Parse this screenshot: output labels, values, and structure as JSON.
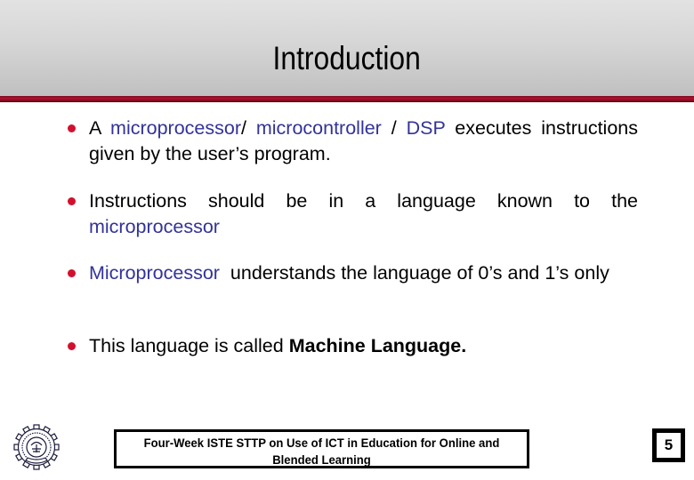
{
  "slide": {
    "title": "Introduction",
    "colors": {
      "accent_bar": "#b0102e",
      "bullet": "#d2102e",
      "highlight_text": "#333399",
      "header_gradient_top": "#e2e2e2",
      "header_gradient_bottom": "#c0c0c0"
    }
  },
  "bullets": [
    {
      "segments": [
        {
          "text": "A ",
          "style": "normal"
        },
        {
          "text": "microprocessor",
          "style": "blue"
        },
        {
          "text": "/ ",
          "style": "normal"
        },
        {
          "text": "microcontroller",
          "style": "blue"
        },
        {
          "text": " / ",
          "style": "normal"
        },
        {
          "text": "DSP",
          "style": "blue"
        },
        {
          "text": " executes instructions given by the user’s program.",
          "style": "normal"
        }
      ]
    },
    {
      "segments": [
        {
          "text": "Instructions should be in a language known to the ",
          "style": "normal"
        },
        {
          "text": "microprocessor",
          "style": "blue"
        }
      ]
    },
    {
      "segments": [
        {
          "text": "Microprocessor",
          "style": "blue"
        },
        {
          "text": "  understands the language of 0’s and 1’s only",
          "style": "normal"
        }
      ]
    },
    {
      "segments": [
        {
          "text": "This language is called ",
          "style": "normal"
        },
        {
          "text": "Machine Language.",
          "style": "bold"
        }
      ]
    }
  ],
  "footer": {
    "logo_icon": "iit-bombay-gear-emblem-icon",
    "text": "Four-Week ISTE STTP on Use of ICT in Education for Online and Blended Learning",
    "page_number": "5"
  }
}
